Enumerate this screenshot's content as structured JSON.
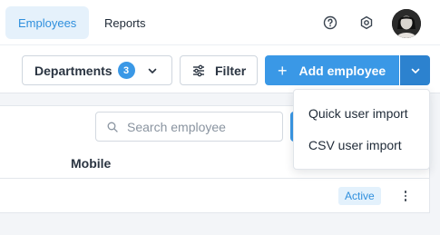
{
  "nav": {
    "tabs": [
      {
        "label": "Employees",
        "active": true
      },
      {
        "label": "Reports",
        "active": false
      }
    ],
    "icons": [
      "help-icon",
      "settings-icon"
    ],
    "avatar": "user-avatar"
  },
  "toolbar": {
    "departments_label": "Departments",
    "departments_count": "3",
    "filter_label": "Filter",
    "add_label": "Add employee",
    "add_prefix": "+"
  },
  "search": {
    "placeholder": "Search employee"
  },
  "table": {
    "columns": [
      "Mobile"
    ],
    "rows": [
      {
        "status": "Active"
      }
    ]
  },
  "add_menu": {
    "items": [
      "Quick user import",
      "CSV user import"
    ]
  },
  "colors": {
    "accent": "#3a98e6",
    "accent_dark": "#2c82cf",
    "active_tab_bg": "#e5f1fb"
  }
}
